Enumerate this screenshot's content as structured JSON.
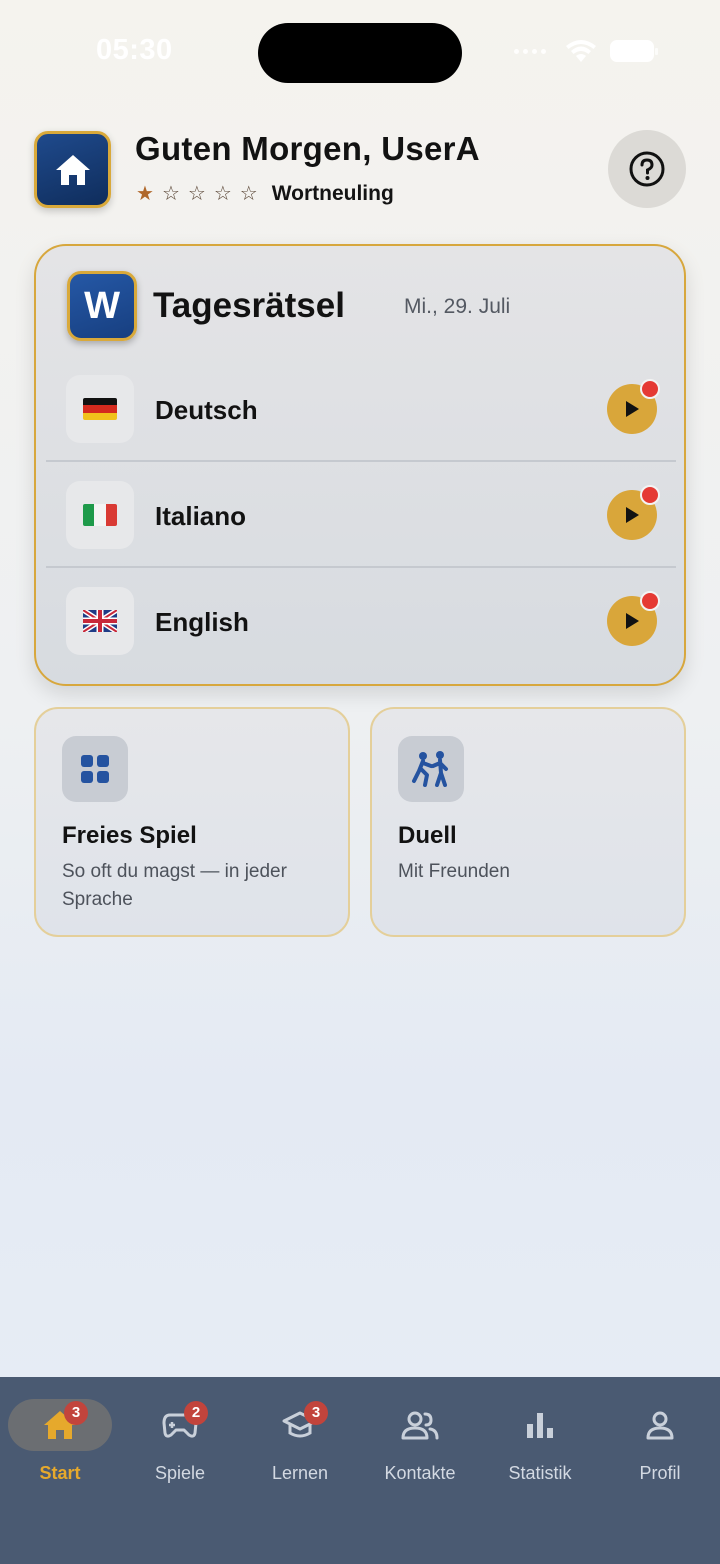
{
  "status_bar": {
    "time": "05:30"
  },
  "header": {
    "greeting": "Guten Morgen, UserA",
    "rank_stars_filled": 1,
    "rank_stars_total": 5,
    "rank_label": "Wortneuling",
    "help_icon": "question-circle-icon"
  },
  "daily": {
    "badge_letter": "W",
    "title": "Tagesrätsel",
    "date": "Mi., 29. Juli",
    "languages": [
      {
        "name": "Deutsch",
        "flag": "flag-de"
      },
      {
        "name": "Italiano",
        "flag": "flag-it"
      },
      {
        "name": "English",
        "flag": "flag-gb"
      }
    ]
  },
  "modes": [
    {
      "title": "Freies Spiel",
      "subtitle": "So oft du magst — in jeder Sprache",
      "icon": "grid-icon"
    },
    {
      "title": "Duell",
      "subtitle": "Mit Freunden",
      "icon": "duel-icon"
    }
  ],
  "tabbar": {
    "tabs": [
      {
        "label": "Start",
        "icon": "home-icon",
        "badge": "3",
        "active": true
      },
      {
        "label": "Spiele",
        "icon": "gamepad-icon",
        "badge": "2"
      },
      {
        "label": "Lernen",
        "icon": "graduation-cap-icon",
        "badge": "3"
      },
      {
        "label": "Kontakte",
        "icon": "contacts-icon"
      },
      {
        "label": "Statistik",
        "icon": "bar-chart-icon"
      },
      {
        "label": "Profil",
        "icon": "person-icon"
      }
    ]
  },
  "colors": {
    "accent_gold": "#d9a63a",
    "navy": "#173f80",
    "tabbar_bg": "#4a5a72",
    "notification_red": "#e53a34"
  }
}
